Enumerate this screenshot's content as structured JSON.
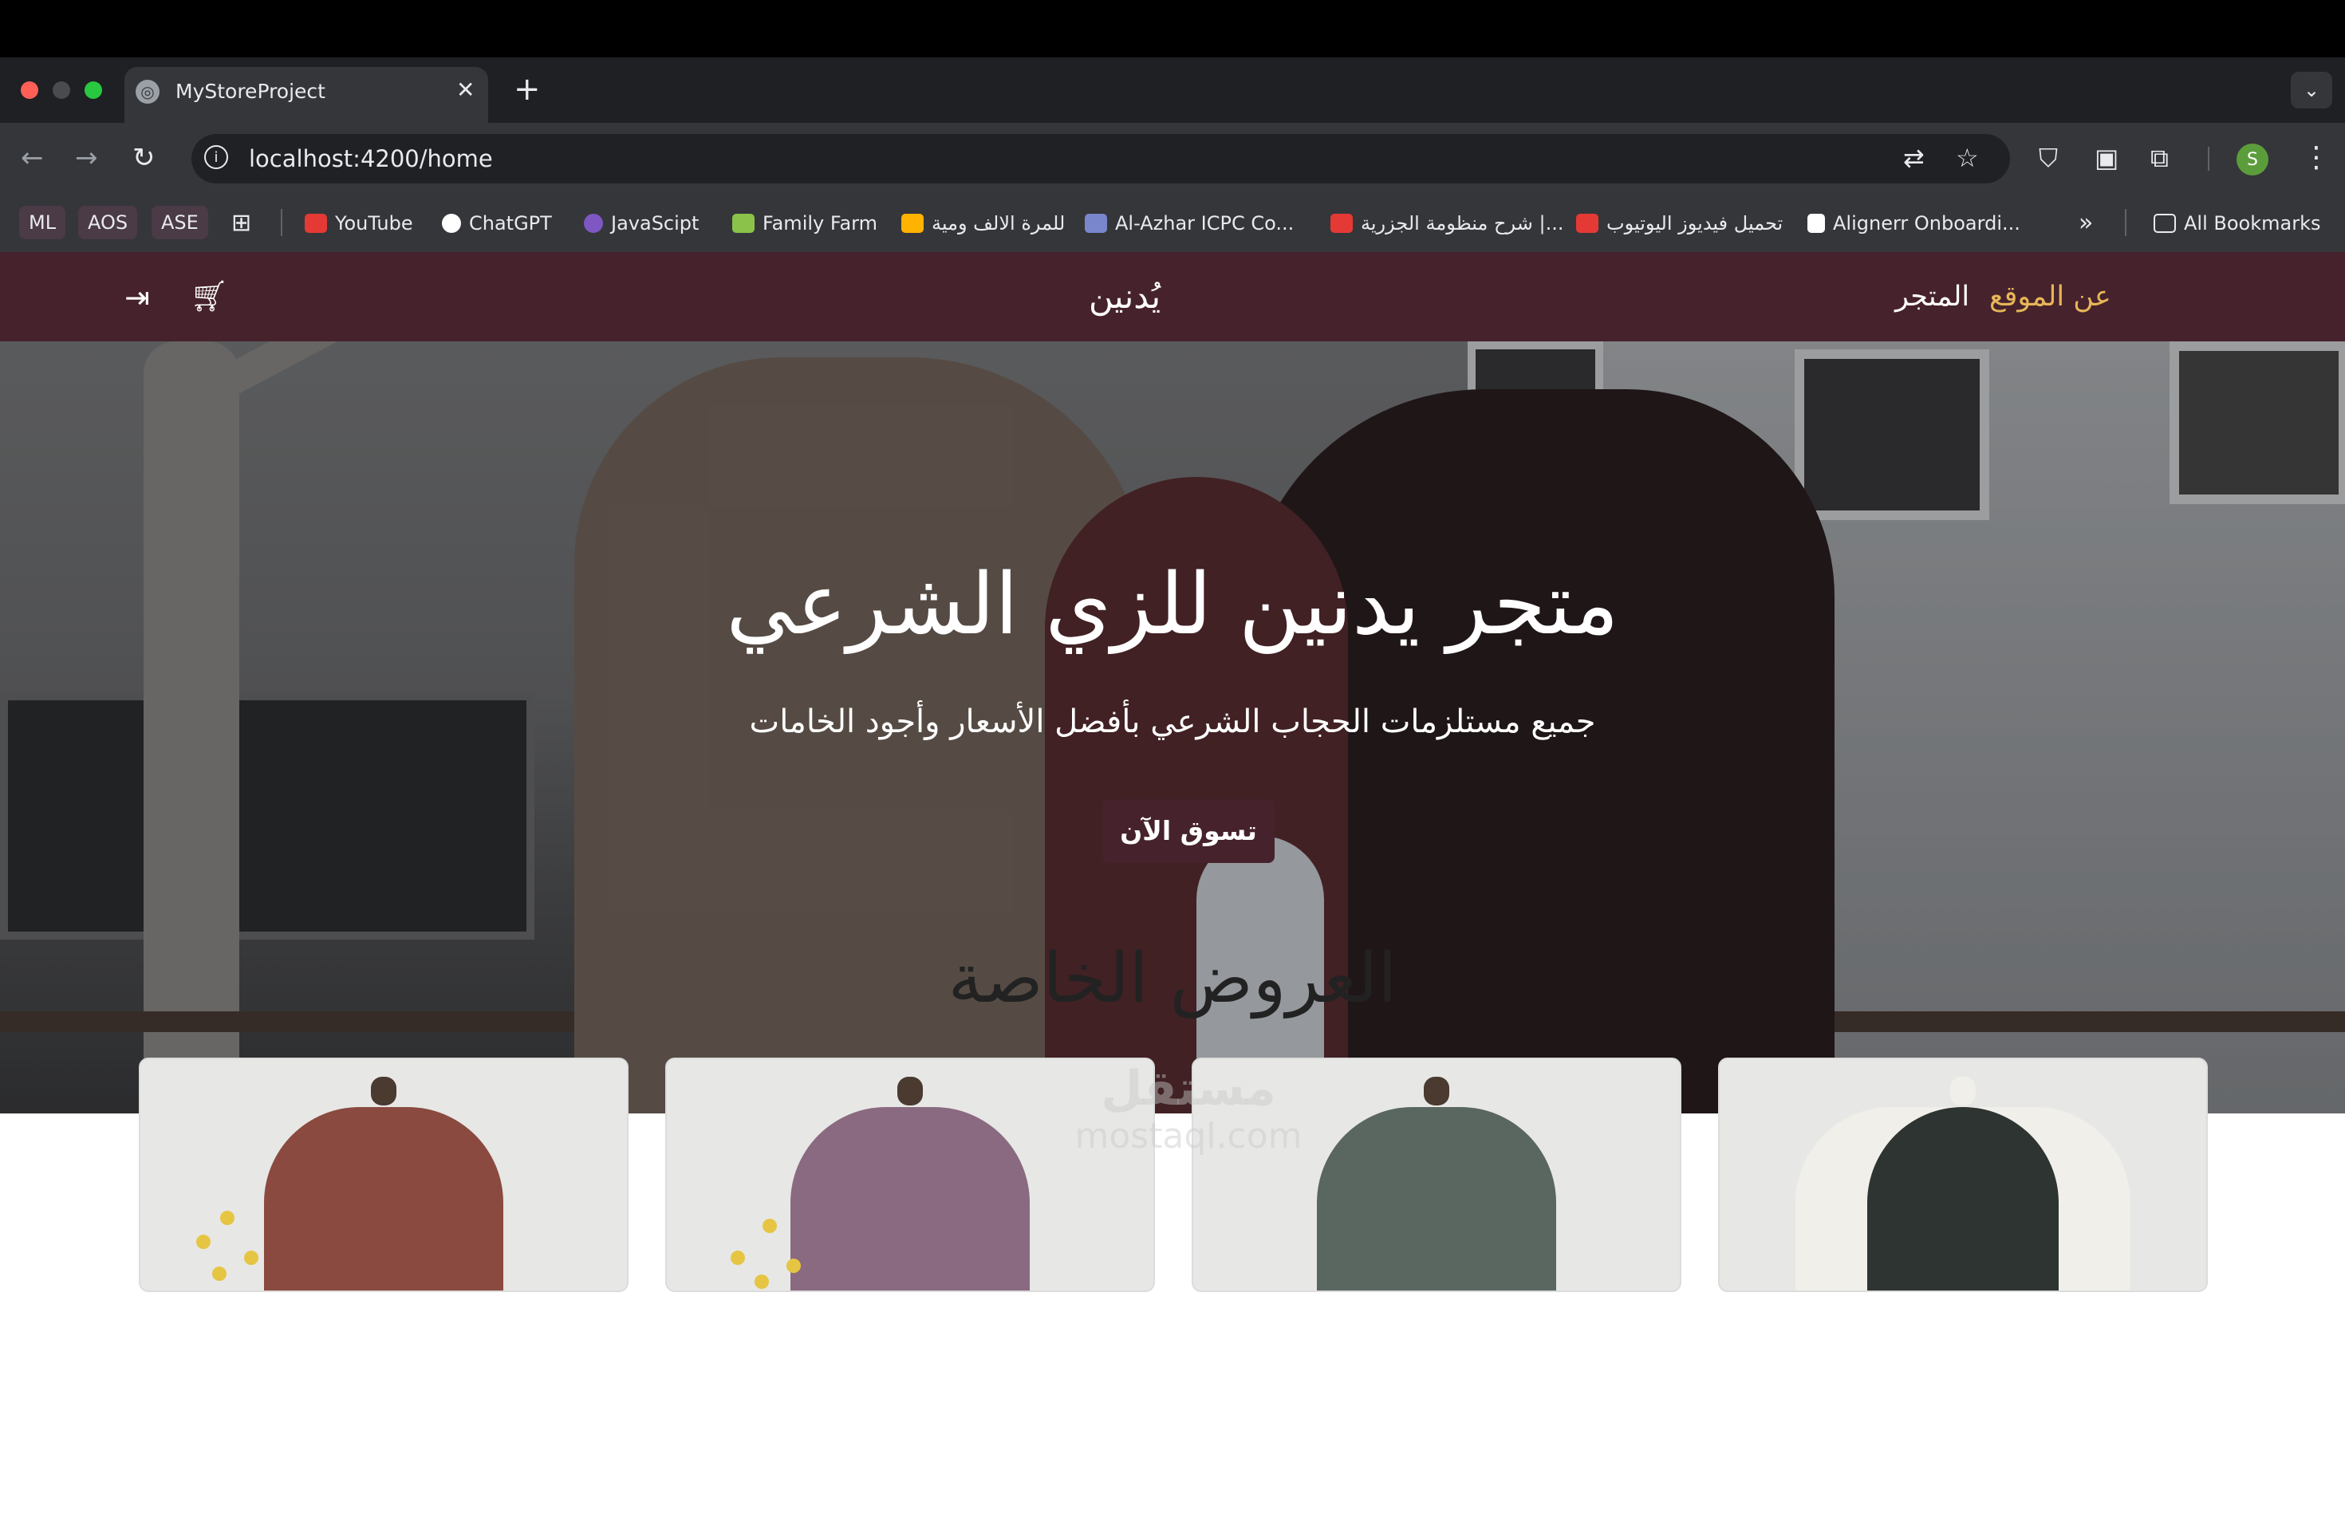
{
  "browser": {
    "tab_title": "MyStoreProject",
    "url": "localhost:4200/home",
    "profile_initial": "S",
    "bookmarks": [
      {
        "label": "ML",
        "type": "chip"
      },
      {
        "label": "AOS",
        "type": "chip"
      },
      {
        "label": "ASE",
        "type": "chip"
      },
      {
        "label": "YouTube",
        "icon": "youtube-icon",
        "color": "#e53935"
      },
      {
        "label": "ChatGPT",
        "icon": "chatgpt-icon",
        "color": "#ffffff"
      },
      {
        "label": "JavaScipt",
        "icon": "javascript-icon",
        "color": "#7e57c2"
      },
      {
        "label": "Family Farm",
        "icon": "family-farm-icon",
        "color": "#8bc34a"
      },
      {
        "label": "للمرة الالف ومية",
        "icon": "chart-icon",
        "color": "#ffb300"
      },
      {
        "label": "Al-Azhar ICPC Co...",
        "icon": "icpc-icon",
        "color": "#7986cb"
      },
      {
        "label": "شرح منظومة الجزرية |...",
        "icon": "youtube-icon",
        "color": "#e53935"
      },
      {
        "label": "تحميل فيديوز اليوتيوب",
        "icon": "download-icon",
        "color": "#e53935"
      },
      {
        "label": "Alignerr Onboardi...",
        "icon": "alignerr-icon",
        "color": "#ffffff"
      }
    ],
    "all_bookmarks": "All Bookmarks"
  },
  "site": {
    "logo": "يُدنين",
    "nav": {
      "store": "المتجر",
      "about": "عن الموقع"
    },
    "brand_color": "#46222c",
    "accent_color": "#e6b658"
  },
  "hero": {
    "title": "متجر يدنين للزي الشرعي",
    "subtitle": "جميع مستلزمات الحجاب الشرعي بأفضل الأسعار وأجود الخامات",
    "cta": "تسوق الآن"
  },
  "offers": {
    "title": "العروض الخاصة",
    "products": [
      {
        "color": "#8a4a40"
      },
      {
        "color": "#8a6a80"
      },
      {
        "color": "#5a6660"
      },
      {
        "color": "#2e3432"
      }
    ]
  },
  "watermark": {
    "text": "مستقل",
    "sub": "mostaql.com"
  }
}
